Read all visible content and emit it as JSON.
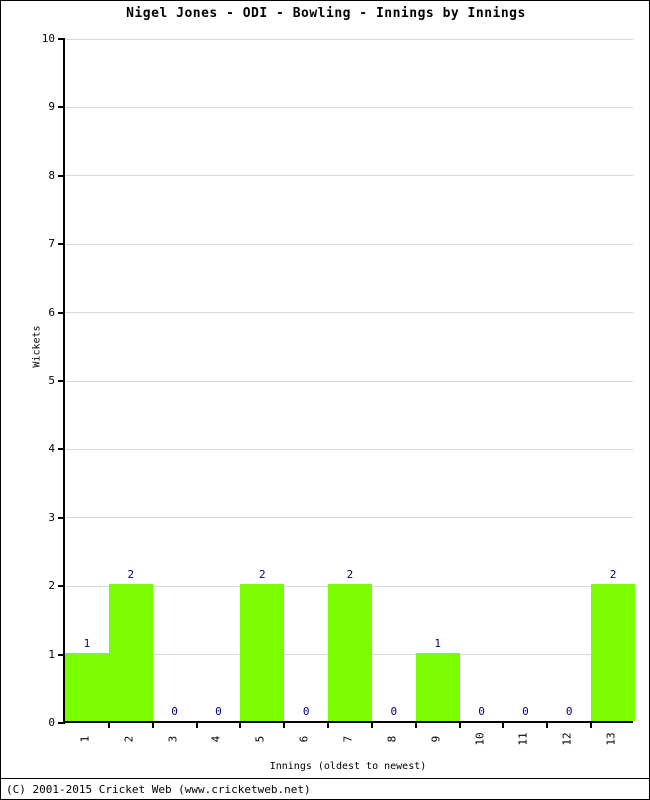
{
  "chart_data": {
    "type": "bar",
    "title": "Nigel Jones - ODI - Bowling - Innings by Innings",
    "xlabel": "Innings (oldest to newest)",
    "ylabel": "Wickets",
    "categories": [
      "1",
      "2",
      "3",
      "4",
      "5",
      "6",
      "7",
      "8",
      "9",
      "10",
      "11",
      "12",
      "13"
    ],
    "values": [
      1,
      2,
      0,
      0,
      2,
      0,
      2,
      0,
      1,
      0,
      0,
      0,
      2
    ],
    "value_labels": [
      "1",
      "2",
      "0",
      "0",
      "2",
      "0",
      "2",
      "0",
      "1",
      "0",
      "0",
      "0",
      "2"
    ],
    "ylim": [
      0,
      10
    ],
    "ytick_labels": [
      "10",
      "9",
      "8",
      "7",
      "6",
      "5",
      "4",
      "3",
      "2",
      "1",
      "0"
    ],
    "ytick_values": [
      10,
      9,
      8,
      7,
      6,
      5,
      4,
      3,
      2,
      1,
      0
    ],
    "grid": true,
    "legend": "none",
    "bar_color": "#7CFC00",
    "value_label_color": "#000080",
    "grid_color": "#D8D8D8",
    "axis_color": "#000000"
  },
  "footer": {
    "copyright": "(C) 2001-2015 Cricket Web (www.cricketweb.net)"
  }
}
